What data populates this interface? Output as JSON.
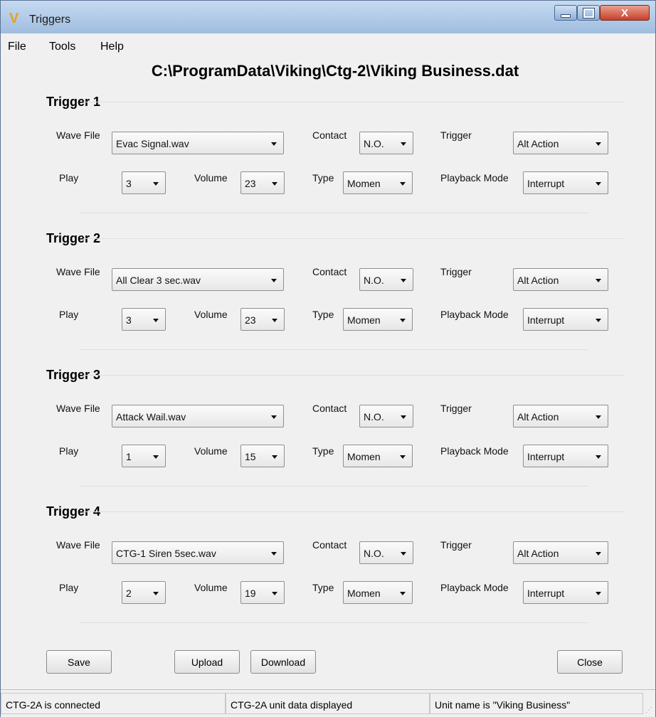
{
  "window": {
    "title": "Triggers",
    "app_icon": "viking-v-icon",
    "controls": [
      "minimize-icon",
      "maximize-icon",
      "close-icon"
    ],
    "close_glyph": "X"
  },
  "menu": {
    "file": "File",
    "tools": "Tools",
    "help": "Help"
  },
  "file_path": "C:\\ProgramData\\Viking\\Ctg-2\\Viking Business.dat",
  "labels": {
    "wave_file": "Wave File",
    "contact": "Contact",
    "trigger": "Trigger",
    "play": "Play",
    "volume": "Volume",
    "type": "Type",
    "playback_mode": "Playback Mode"
  },
  "triggers": [
    {
      "title": "Trigger 1",
      "wave_file": "Evac Signal.wav",
      "contact": "N.O.",
      "trigger": "Alt Action",
      "play": "3",
      "volume": "23",
      "type": "Momen",
      "playback_mode": "Interrupt"
    },
    {
      "title": "Trigger 2",
      "wave_file": "All Clear 3 sec.wav",
      "contact": "N.O.",
      "trigger": "Alt Action",
      "play": "3",
      "volume": "23",
      "type": "Momen",
      "playback_mode": "Interrupt"
    },
    {
      "title": "Trigger 3",
      "wave_file": "Attack Wail.wav",
      "contact": "N.O.",
      "trigger": "Alt Action",
      "play": "1",
      "volume": "15",
      "type": "Momen",
      "playback_mode": "Interrupt"
    },
    {
      "title": "Trigger 4",
      "wave_file": "CTG-1 Siren 5sec.wav",
      "contact": "N.O.",
      "trigger": "Alt Action",
      "play": "2",
      "volume": "19",
      "type": "Momen",
      "playback_mode": "Interrupt"
    }
  ],
  "buttons": {
    "save": "Save",
    "upload": "Upload",
    "download": "Download",
    "close": "Close"
  },
  "status": {
    "connection": "CTG-2A is connected",
    "data": "CTG-2A unit data displayed",
    "unit_name": "Unit name is \"Viking Business\""
  }
}
